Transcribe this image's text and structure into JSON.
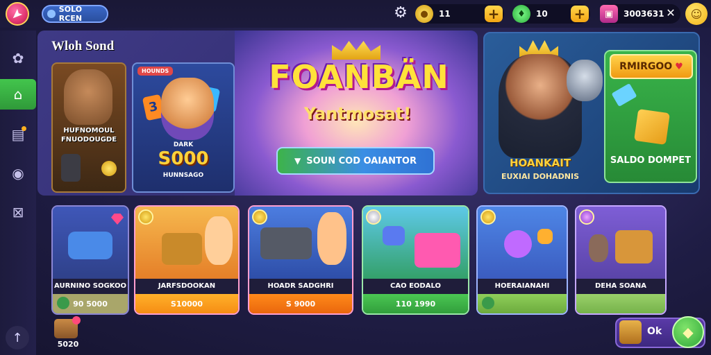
{
  "topbar": {
    "player_name": "SOLO RCEN",
    "currency1": "11",
    "currency2": "10",
    "currency3": "3003631",
    "close_symbol": "✕",
    "plus_symbol": "+"
  },
  "section_title": "Wloh Sond",
  "featured": {
    "card_a_title": "HUFNOMOUL FNUODOUGDE",
    "card_b_tag": "HOUNDS",
    "card_b_small": "DARK",
    "card_b_big": "S000",
    "card_b_footer": "HUNNSAGO",
    "big_title": "FOANBÄN",
    "sub_title": "Yantmosat!",
    "cta_label": "SOUN COD OAIANTOR"
  },
  "promo": {
    "hero_name": "HOANKAIT",
    "hero_sub": "EUXIAI DOHADNIS",
    "offer_title": "RMIRGOO",
    "offer_label": "SALDO DOMPET"
  },
  "games": [
    {
      "name": "AURNINO SOGKOO",
      "price": "90 5000"
    },
    {
      "name": "JARFSDOOKAN",
      "price": "S10000"
    },
    {
      "name": "HOADR SADGHRI",
      "price": "S 9000"
    },
    {
      "name": "CAO EODALO",
      "price": "110 1990"
    },
    {
      "name": "HOERAIANAHI",
      "price": ""
    },
    {
      "name": "DEHA SOANA",
      "price": ""
    }
  ],
  "bottom": {
    "item_count": "5020",
    "ok_label": "Ok"
  },
  "icons": {
    "logo": "star-logo-icon",
    "settings": "gear-icon",
    "coin": "coin-icon",
    "gem": "gem-icon",
    "shop": "shop-icon",
    "smile": "smile-icon"
  },
  "colors": {
    "accent_green": "#3db34a",
    "accent_gold": "#ffd24a",
    "accent_blue": "#3b8ee4",
    "background": "#1f1d45"
  }
}
